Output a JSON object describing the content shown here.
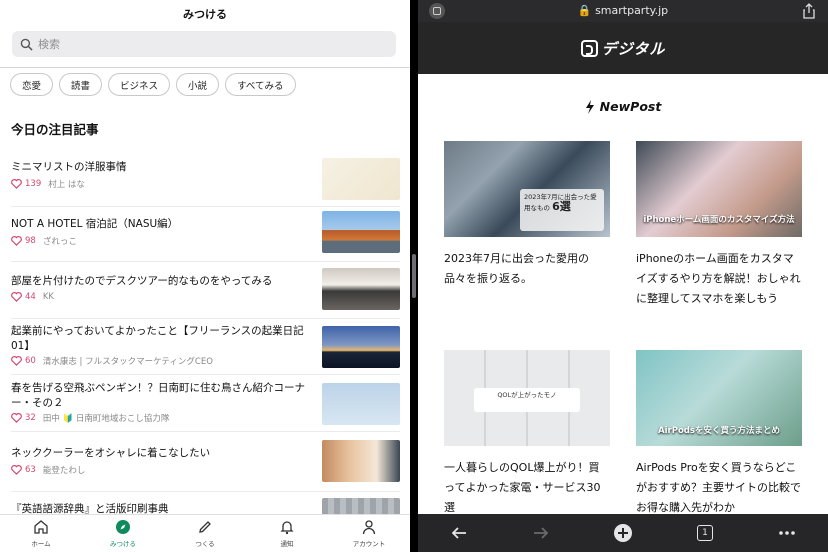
{
  "left": {
    "title": "みつける",
    "search_placeholder": "検索",
    "chips": [
      "恋愛",
      "読書",
      "ビジネス",
      "小説",
      "すべてみる"
    ],
    "section_title": "今日の注目記事",
    "articles": [
      {
        "title": "ミニマリストの洋服事情",
        "likes": "139",
        "author": "村上 はな"
      },
      {
        "title": "NOT A HOTEL 宿泊記（NASU編）",
        "likes": "98",
        "author": "ざれっこ"
      },
      {
        "title": "部屋を片付けたのでデスクツアー的なものをやってみる",
        "likes": "44",
        "author": "KK"
      },
      {
        "title": "起業前にやっておいてよかったこと【フリーランスの起業日記01】",
        "likes": "60",
        "author": "清水康志 | フルスタックマーケティングCEO"
      },
      {
        "title": "春を告げる空飛ぶペンギン！？日南町に住む鳥さん紹介コーナー・その２",
        "likes": "32",
        "author": "田中 🔰 日南町地域おこし協力隊"
      },
      {
        "title": "ネッククーラーをオシャレに着こなしたい",
        "likes": "63",
        "author": "能登たわし"
      },
      {
        "title": "『英語語源辞典』と活版印刷事典"
      }
    ],
    "tabs": [
      "ホーム",
      "みつける",
      "つくる",
      "通知",
      "アカウント"
    ]
  },
  "right": {
    "url": "smartparty.jp",
    "site_name": "デジタル",
    "section": "NewPost",
    "cards": [
      {
        "title": "2023年7月に出会った愛用の品々を振り返る。",
        "image_caption": "2023年7月に出会った愛用なもの",
        "image_badge": "6選"
      },
      {
        "title": "iPhoneのホーム画面をカスタマイズするやり方を解説！おしゃれに整理してスマホを楽しもう",
        "image_caption": "iPhoneホーム画面のカスタマイズ方法"
      },
      {
        "title": "一人暮らしのQOL爆上がり！買ってよかった家電・サービス30選",
        "image_caption": "QOLが上がったモノ"
      },
      {
        "title": "AirPods Proを安く買うならどこがおすすめ？主要サイトの比較でお得な購入先がわか",
        "image_caption": "AirPodsを安く買う方法まとめ"
      }
    ],
    "tab_count": "1"
  },
  "colors": {
    "accent_green": "#0e8a5f",
    "like_pink": "#d6476c",
    "site_dark": "#262626"
  }
}
